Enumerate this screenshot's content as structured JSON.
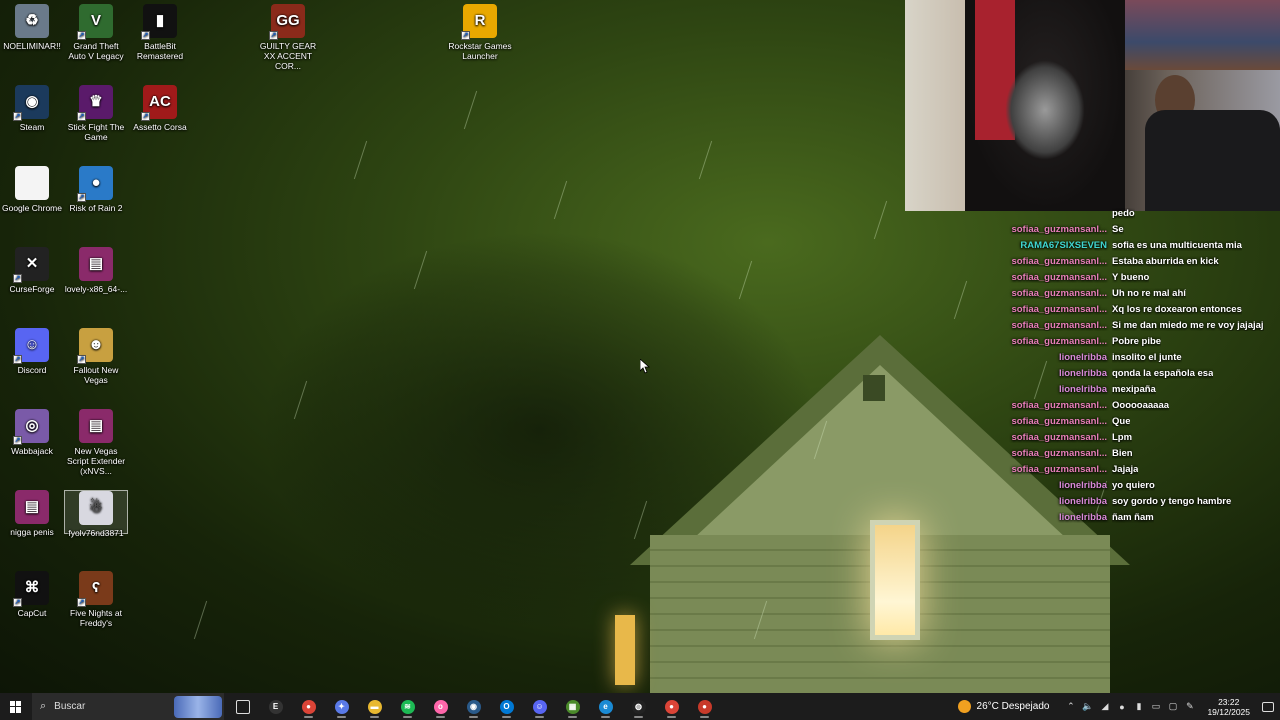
{
  "desktop": {
    "icons": [
      {
        "label": "NOELIMINAR!!",
        "icon": "recycle-bin-icon",
        "color": "#6a7a8a",
        "glyph": "♻"
      },
      {
        "label": "Grand Theft Auto V Legacy",
        "icon": "gta-v-icon",
        "color": "#2f6b2f",
        "glyph": "V"
      },
      {
        "label": "BattleBit Remastered",
        "icon": "battlebit-icon",
        "color": "#111111",
        "glyph": "▮"
      },
      {
        "label": "GUILTY GEAR XX ACCENT COR...",
        "icon": "guilty-gear-icon",
        "color": "#8a2a1a",
        "glyph": "GG"
      },
      {
        "label": "Rockstar Games Launcher",
        "icon": "rockstar-icon",
        "color": "#e8a800",
        "glyph": "R"
      },
      {
        "label": "Steam",
        "icon": "steam-icon",
        "color": "#1b3a5c",
        "glyph": "◉"
      },
      {
        "label": "Stick Fight The Game",
        "icon": "stick-fight-icon",
        "color": "#5a1a6a",
        "glyph": "♛"
      },
      {
        "label": "Assetto Corsa",
        "icon": "assetto-corsa-icon",
        "color": "#a01a1a",
        "glyph": "AC"
      },
      {
        "label": "Google Chrome",
        "icon": "blank-file-icon",
        "color": "#f4f4f4",
        "glyph": ""
      },
      {
        "label": "Risk of Rain 2",
        "icon": "risk-of-rain-icon",
        "color": "#2a7ac8",
        "glyph": "●"
      },
      {
        "label": "CurseForge",
        "icon": "curseforge-icon",
        "color": "#222222",
        "glyph": "✕"
      },
      {
        "label": "lovely-x86_64-...",
        "icon": "winrar-archive-icon",
        "color": "#8a2a6a",
        "glyph": "▤"
      },
      {
        "label": "Discord",
        "icon": "discord-icon",
        "color": "#5865f2",
        "glyph": "☺"
      },
      {
        "label": "Fallout New Vegas",
        "icon": "fallout-icon",
        "color": "#c8a040",
        "glyph": "☻"
      },
      {
        "label": "Wabbajack",
        "icon": "wabbajack-icon",
        "color": "#7a5aa8",
        "glyph": "◎"
      },
      {
        "label": "New Vegas Script Extender (xNVS...",
        "icon": "winrar-archive-icon",
        "color": "#8a2a6a",
        "glyph": "▤"
      },
      {
        "label": "nigga penis",
        "icon": "winrar-archive-icon",
        "color": "#8a2a6a",
        "glyph": "▤"
      },
      {
        "label": "fyolv76nd3871",
        "icon": "image-file-icon",
        "color": "#d8d8e0",
        "glyph": "☃"
      },
      {
        "label": "CapCut",
        "icon": "capcut-icon",
        "color": "#111111",
        "glyph": "⌘"
      },
      {
        "label": "Five Nights at Freddy's",
        "icon": "fnaf-icon",
        "color": "#7a3a1a",
        "glyph": "ʕ"
      }
    ]
  },
  "chat": {
    "messages": [
      {
        "user": "",
        "user_color": "#e87fb8",
        "text": "pedo"
      },
      {
        "user": "sofiaa_guzmansanl...",
        "user_color": "#e87fb8",
        "text": "Se"
      },
      {
        "user": "RAMA67SIXSEVEN",
        "user_color": "#3fd6d0",
        "text": "sofia es una multicuenta mia"
      },
      {
        "user": "sofiaa_guzmansanl...",
        "user_color": "#e87fb8",
        "text": "Estaba aburrida en kick"
      },
      {
        "user": "sofiaa_guzmansanl...",
        "user_color": "#e87fb8",
        "text": "Y bueno"
      },
      {
        "user": "sofiaa_guzmansanl...",
        "user_color": "#e87fb8",
        "text": "Uh no re mal ahí"
      },
      {
        "user": "sofiaa_guzmansanl...",
        "user_color": "#e87fb8",
        "text": "Xq los re doxearon entonces"
      },
      {
        "user": "sofiaa_guzmansanl...",
        "user_color": "#e87fb8",
        "text": "Si me dan miedo me re voy jajajaj"
      },
      {
        "user": "sofiaa_guzmansanl...",
        "user_color": "#e87fb8",
        "text": "Pobre pibe"
      },
      {
        "user": "lionelribba",
        "user_color": "#d98ad8",
        "text": "insolito el junte"
      },
      {
        "user": "lionelribba",
        "user_color": "#d98ad8",
        "text": "qonda la española esa"
      },
      {
        "user": "lionelribba",
        "user_color": "#d98ad8",
        "text": "mexipaña"
      },
      {
        "user": "sofiaa_guzmansanl...",
        "user_color": "#e87fb8",
        "text": "Oooooaaaaa"
      },
      {
        "user": "sofiaa_guzmansanl...",
        "user_color": "#e87fb8",
        "text": "Que"
      },
      {
        "user": "sofiaa_guzmansanl...",
        "user_color": "#e87fb8",
        "text": "Lpm"
      },
      {
        "user": "sofiaa_guzmansanl...",
        "user_color": "#e87fb8",
        "text": "Bien"
      },
      {
        "user": "sofiaa_guzmansanl...",
        "user_color": "#e87fb8",
        "text": "Jajaja"
      },
      {
        "user": "lionelribba",
        "user_color": "#d98ad8",
        "text": "yo quiero"
      },
      {
        "user": "lionelribba",
        "user_color": "#d98ad8",
        "text": "soy gordo y tengo hambre"
      },
      {
        "user": "lionelribba",
        "user_color": "#d98ad8",
        "text": "ñam ñam"
      }
    ]
  },
  "taskbar": {
    "search_placeholder": "Buscar",
    "apps": [
      {
        "name": "task-view",
        "icon": "task-view-icon",
        "color": "#555555",
        "glyph": "▭"
      },
      {
        "name": "epic-games",
        "icon": "epic-games-icon",
        "color": "#333333",
        "glyph": "E"
      },
      {
        "name": "chrome",
        "icon": "chrome-icon",
        "color": "#db4437",
        "glyph": "●"
      },
      {
        "name": "copilot",
        "icon": "copilot-icon",
        "color": "#5a7ae8",
        "glyph": "✦"
      },
      {
        "name": "file-explorer",
        "icon": "folder-icon",
        "color": "#e8b830",
        "glyph": "▬"
      },
      {
        "name": "spotify",
        "icon": "spotify-icon",
        "color": "#1db954",
        "glyph": "≋"
      },
      {
        "name": "osu",
        "icon": "osu-icon",
        "color": "#ff66aa",
        "glyph": "o"
      },
      {
        "name": "steam",
        "icon": "steam-icon",
        "color": "#2a5a8a",
        "glyph": "◉"
      },
      {
        "name": "outlook",
        "icon": "outlook-icon",
        "color": "#0078d4",
        "glyph": "O"
      },
      {
        "name": "discord",
        "icon": "discord-icon",
        "color": "#5865f2",
        "glyph": "☺"
      },
      {
        "name": "minecraft",
        "icon": "minecraft-icon",
        "color": "#4a8a2a",
        "glyph": "▦"
      },
      {
        "name": "edge",
        "icon": "edge-icon",
        "color": "#1a8ad4",
        "glyph": "e"
      },
      {
        "name": "obs",
        "icon": "obs-icon",
        "color": "#222222",
        "glyph": "◍"
      },
      {
        "name": "chrome-profile",
        "icon": "chrome-icon",
        "color": "#db4437",
        "glyph": "●"
      },
      {
        "name": "chrome-profile-2",
        "icon": "chrome-icon",
        "color": "#c83a2a",
        "glyph": "●"
      }
    ],
    "weather": {
      "text": "26°C  Despejado"
    },
    "clock": {
      "time": "23:22",
      "date": "19/12/2025"
    }
  }
}
